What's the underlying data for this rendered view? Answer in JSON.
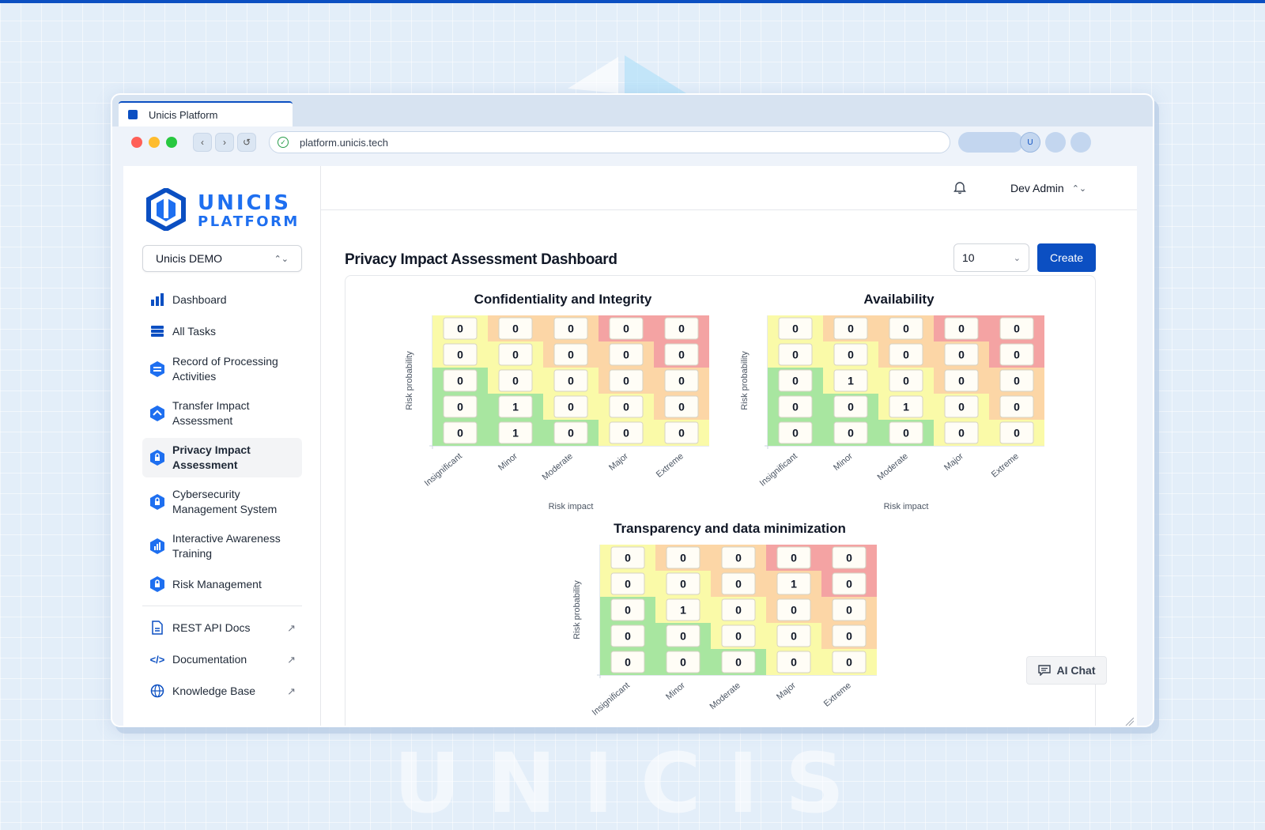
{
  "browser": {
    "tab_title": "Unicis Platform",
    "url": "platform.unicis.tech",
    "avatar_initial": "U"
  },
  "logo": {
    "line1": "UNICIS",
    "line2": "PLATFORM"
  },
  "watermark": "UNICIS",
  "sidebar": {
    "org_selector": "Unicis DEMO",
    "items": [
      {
        "label": "Dashboard",
        "icon": "bar-chart-icon"
      },
      {
        "label": "All Tasks",
        "icon": "stack-icon"
      },
      {
        "label": "Record of Processing Activities",
        "icon": "ropa-shield-icon"
      },
      {
        "label": "Transfer Impact Assessment",
        "icon": "tia-shield-icon"
      },
      {
        "label": "Privacy Impact Assessment",
        "icon": "pia-shield-icon",
        "active": true
      },
      {
        "label": "Cybersecurity Management System",
        "icon": "cyber-shield-icon"
      },
      {
        "label": "Interactive Awareness Training",
        "icon": "training-shield-icon"
      },
      {
        "label": "Risk Management",
        "icon": "risk-shield-icon"
      }
    ],
    "external_links": [
      {
        "label": "REST API Docs",
        "icon": "document-icon"
      },
      {
        "label": "Documentation",
        "icon": "code-icon"
      },
      {
        "label": "Knowledge Base",
        "icon": "globe-icon"
      }
    ]
  },
  "header": {
    "user_name": "Dev Admin"
  },
  "page": {
    "title": "Privacy Impact Assessment Dashboard",
    "page_size": "10",
    "create_label": "Create"
  },
  "ai_chat_label": "AI Chat",
  "colors": {
    "accent": "#0b4fc2",
    "green": "#a8e6a0",
    "yellow": "#fafaa8",
    "orange": "#fcd6a6",
    "red": "#f4a3a3"
  },
  "chart_data": [
    {
      "type": "heatmap",
      "title": "Confidentiality and Integrity",
      "xlabel": "Risk impact",
      "ylabel": "Risk probability",
      "x": [
        "Insignificant",
        "Minor",
        "Moderate",
        "Major",
        "Extreme"
      ],
      "values": [
        [
          0,
          0,
          0,
          0,
          0
        ],
        [
          0,
          0,
          0,
          0,
          0
        ],
        [
          0,
          0,
          0,
          0,
          0
        ],
        [
          0,
          1,
          0,
          0,
          0
        ],
        [
          0,
          1,
          0,
          0,
          0
        ]
      ]
    },
    {
      "type": "heatmap",
      "title": "Availability",
      "xlabel": "Risk impact",
      "ylabel": "Risk probability",
      "x": [
        "Insignificant",
        "Minor",
        "Moderate",
        "Major",
        "Extreme"
      ],
      "values": [
        [
          0,
          0,
          0,
          0,
          0
        ],
        [
          0,
          0,
          0,
          0,
          0
        ],
        [
          0,
          1,
          0,
          0,
          0
        ],
        [
          0,
          0,
          1,
          0,
          0
        ],
        [
          0,
          0,
          0,
          0,
          0
        ]
      ]
    },
    {
      "type": "heatmap",
      "title": "Transparency and data minimization",
      "xlabel": "Risk impact",
      "ylabel": "Risk probability",
      "x": [
        "Insignificant",
        "Minor",
        "Moderate",
        "Major",
        "Extreme"
      ],
      "values": [
        [
          0,
          0,
          0,
          0,
          0
        ],
        [
          0,
          0,
          0,
          1,
          0
        ],
        [
          0,
          1,
          0,
          0,
          0
        ],
        [
          0,
          0,
          0,
          0,
          0
        ],
        [
          0,
          0,
          0,
          0,
          0
        ]
      ]
    }
  ]
}
